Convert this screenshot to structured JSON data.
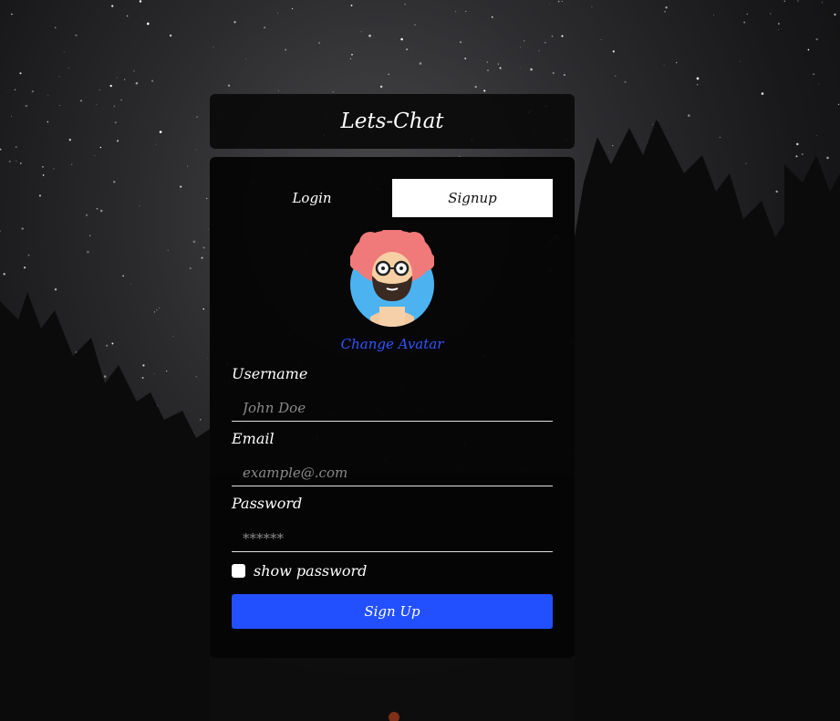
{
  "app": {
    "title": "Lets-Chat"
  },
  "tabs": [
    {
      "label": "Login",
      "active": false
    },
    {
      "label": "Signup",
      "active": true
    }
  ],
  "avatar": {
    "icon": "avatar-bearded-man-icon",
    "change_label": "Change Avatar"
  },
  "form": {
    "username": {
      "label": "Username",
      "placeholder": "John Doe",
      "value": ""
    },
    "email": {
      "label": "Email",
      "placeholder": "example@.com",
      "value": ""
    },
    "password": {
      "label": "Password",
      "placeholder": "******",
      "value": ""
    },
    "show_password": {
      "label": "show password",
      "checked": false
    },
    "submit_label": "Sign Up"
  },
  "colors": {
    "accent": "#2350ff",
    "link": "#2f55ff",
    "card_bg": "#0a0a0a"
  }
}
